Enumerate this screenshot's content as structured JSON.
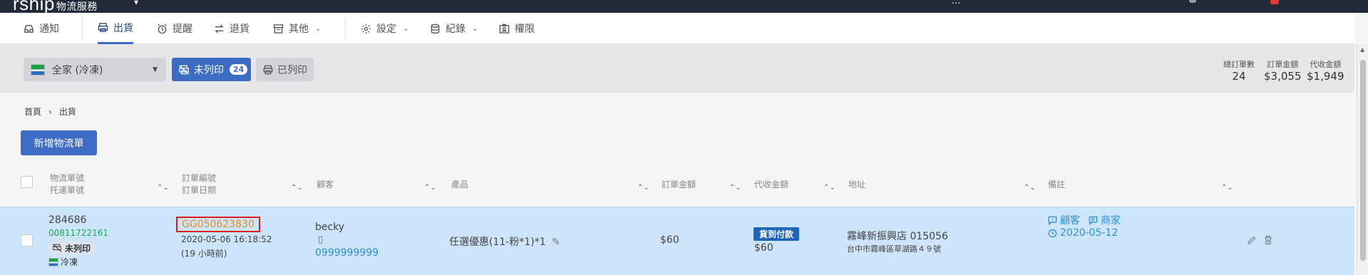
{
  "app": {
    "brand": "rship",
    "brand_sub": "物流服務",
    "user_text": "..."
  },
  "nav": {
    "notify": "通知",
    "shipping": "出貨",
    "reminder": "提醒",
    "returns": "退貨",
    "other": "其他",
    "settings": "設定",
    "records": "紀錄",
    "permissions": "權限"
  },
  "filters": {
    "store": "全家 (冷凍)",
    "unprinted": "未列印",
    "unprinted_count": "24",
    "printed": "已列印"
  },
  "stats": [
    {
      "label": "總訂單數",
      "value": "24"
    },
    {
      "label": "訂單金額",
      "value": "$3,055"
    },
    {
      "label": "代收金額",
      "value": "$1,949"
    }
  ],
  "breadcrumb": {
    "home": "首頁",
    "sep": "›",
    "current": "出貨"
  },
  "add_button": "新增物流單",
  "table": {
    "headers": {
      "logistics_no": "物流單號",
      "tracking_no": "托運單號",
      "order_no": "訂單編號",
      "order_date": "訂單日期",
      "customer": "顧客",
      "product": "產品",
      "order_amount": "訂單金額",
      "cod_amount": "代收金額",
      "address": "地址",
      "notes": "備註"
    },
    "rows": [
      {
        "logistics_no": "284686",
        "tracking_no": "00811722161",
        "print_status": "未列印",
        "temp_type": "冷凍",
        "order_no": "GG050623830",
        "order_datetime": "2020-05-06 16:18:52",
        "order_ago": "(19 小時前)",
        "customer_name": "becky",
        "customer_phone": "0999999999",
        "product": "任選優惠(11-粉*1)*1",
        "order_amount": "$60",
        "payment_type": "貨到付款",
        "cod_amount": "$60",
        "store_name": "霧峰新振興店 015056",
        "store_address": "台中市霧峰區草湖路４９號",
        "note_customer": "顧客",
        "note_merchant": "商家",
        "note_date": "2020-05-12"
      }
    ]
  },
  "colors": {
    "accent": "#3d6cc3",
    "row_selected": "#cde5fb",
    "highlight_border": "#e01b1b",
    "order_link": "#e38c1c"
  }
}
